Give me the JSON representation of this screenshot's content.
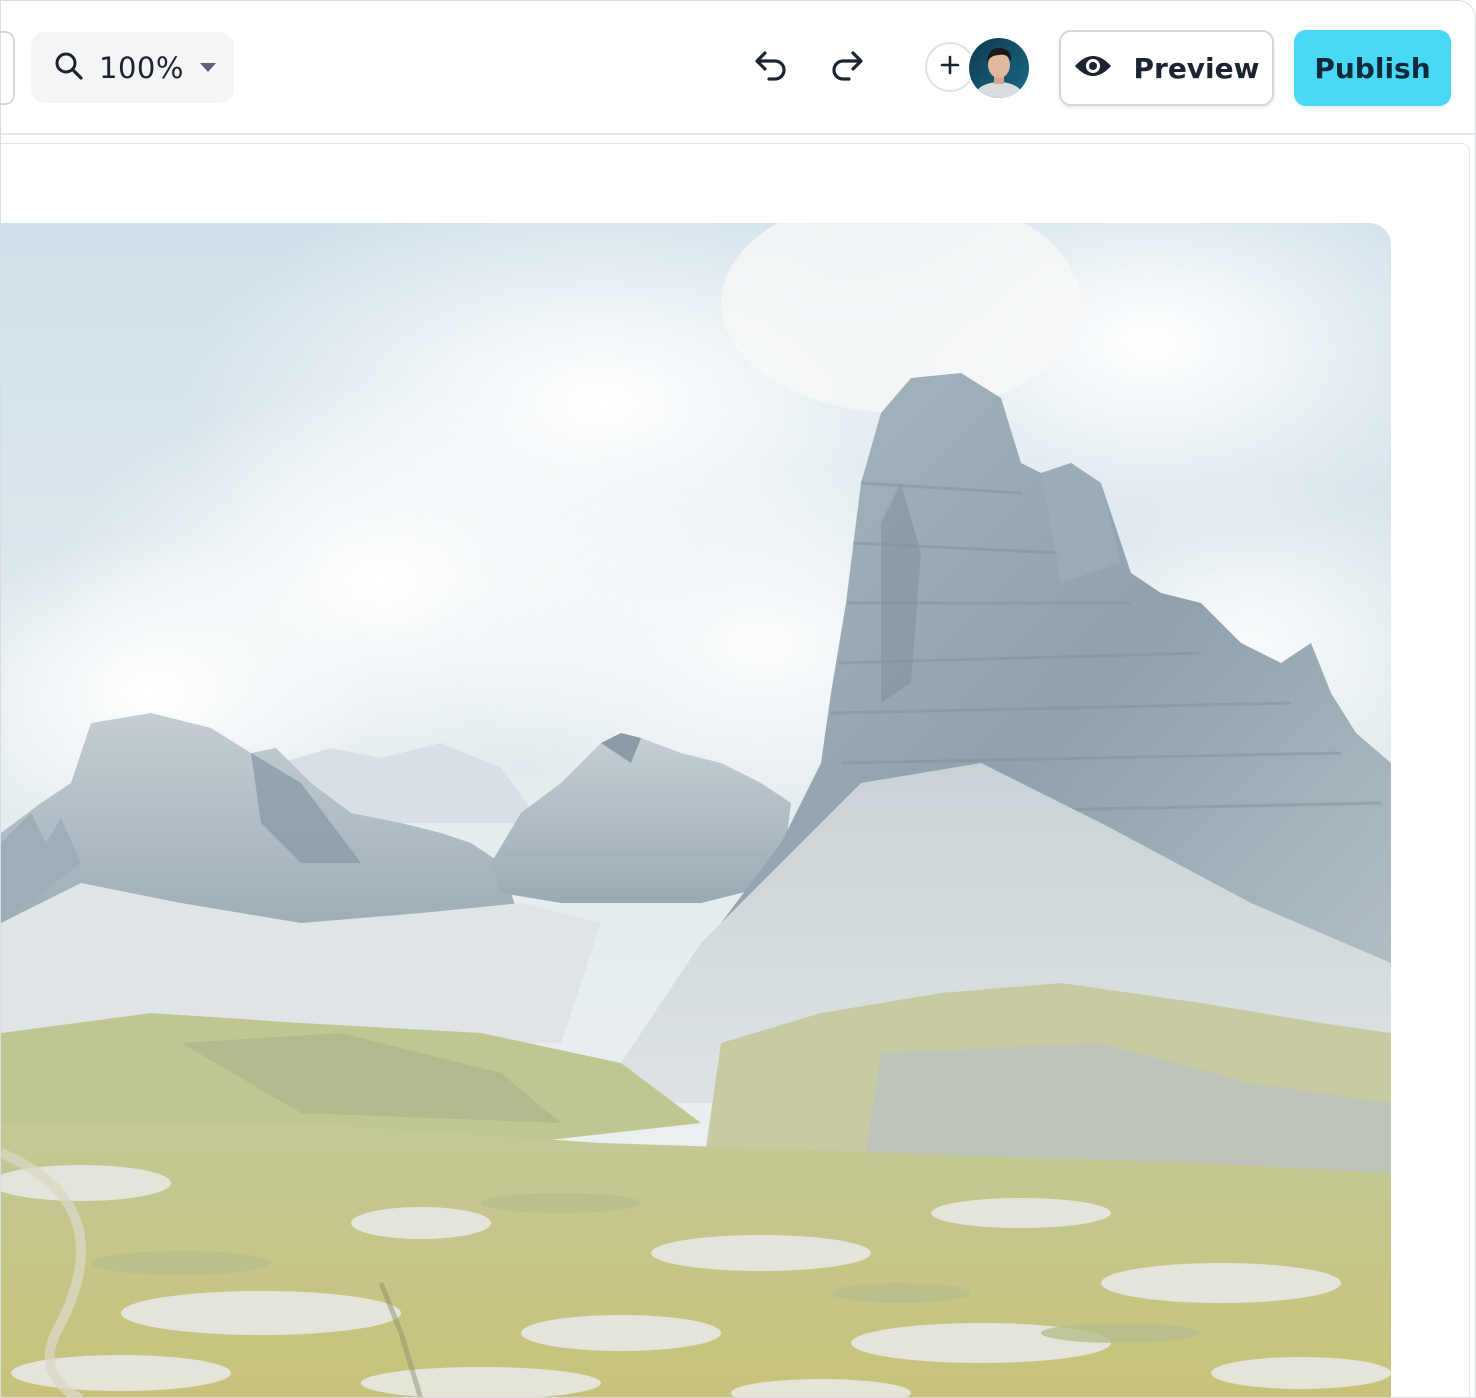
{
  "toolbar": {
    "zoom": {
      "value": "100%"
    },
    "preview_label": "Preview",
    "publish_label": "Publish"
  },
  "colors": {
    "accent": "#4ad8f7",
    "text": "#1b2430",
    "border": "#d3d8de"
  },
  "icons": {
    "zoom": "search-icon",
    "undo": "undo-icon",
    "redo": "redo-icon",
    "add": "plus-icon",
    "preview": "eye-icon"
  }
}
